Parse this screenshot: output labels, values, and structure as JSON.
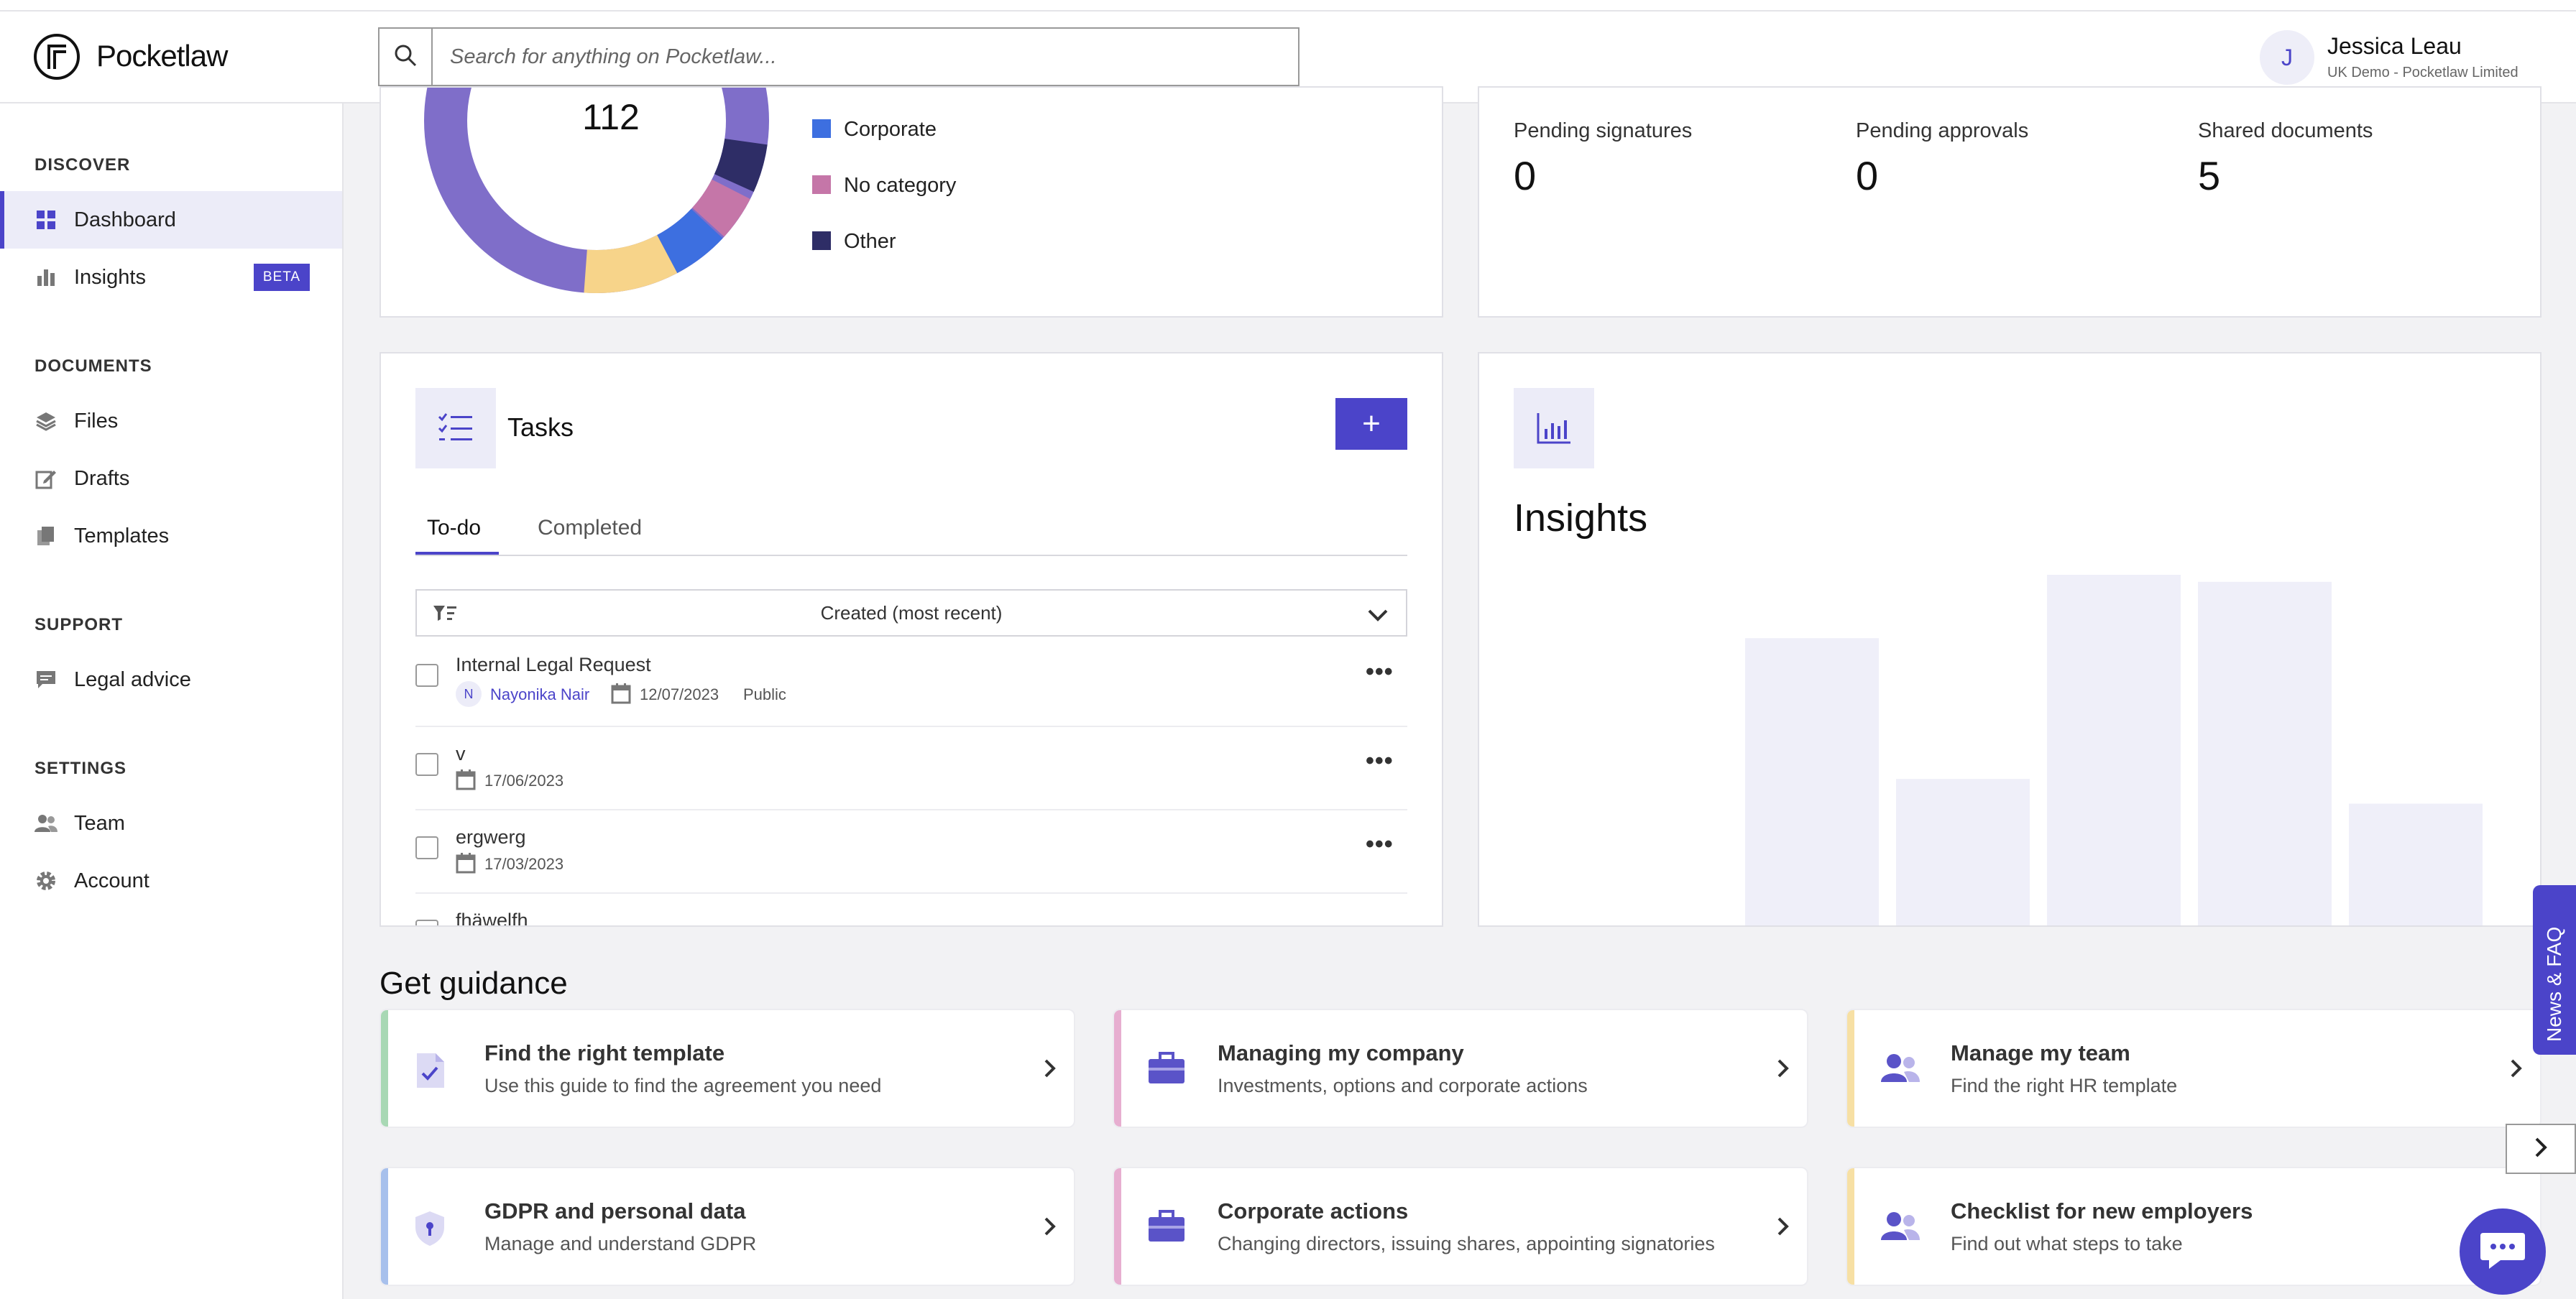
{
  "app": {
    "name": "Pocketlaw"
  },
  "search": {
    "placeholder": "Search for anything on Pocketlaw..."
  },
  "user": {
    "initial": "J",
    "name": "Jessica Leau",
    "org": "UK Demo - Pocketlaw Limited"
  },
  "sidebar": {
    "sections": [
      {
        "heading": "DISCOVER",
        "items": [
          {
            "label": "Dashboard",
            "icon": "grid-icon",
            "active": true
          },
          {
            "label": "Insights",
            "icon": "bar-chart-icon",
            "badge": "BETA"
          }
        ]
      },
      {
        "heading": "DOCUMENTS",
        "items": [
          {
            "label": "Files",
            "icon": "layers-icon"
          },
          {
            "label": "Drafts",
            "icon": "edit-icon"
          },
          {
            "label": "Templates",
            "icon": "copy-icon"
          }
        ]
      },
      {
        "heading": "SUPPORT",
        "items": [
          {
            "label": "Legal advice",
            "icon": "chat-icon"
          }
        ]
      },
      {
        "heading": "SETTINGS",
        "items": [
          {
            "label": "Team",
            "icon": "people-icon"
          },
          {
            "label": "Account",
            "icon": "gear-icon"
          }
        ]
      }
    ]
  },
  "category_chart": {
    "total": "112",
    "legend": [
      {
        "label": "Corporate",
        "color": "#3d6fe0"
      },
      {
        "label": "No category",
        "color": "#c576a8"
      },
      {
        "label": "Other",
        "color": "#2e2d66"
      }
    ],
    "colors": {
      "main": "#7f6ec9",
      "yellow": "#f7d48a"
    }
  },
  "stats": [
    {
      "label": "Pending signatures",
      "value": "0"
    },
    {
      "label": "Pending approvals",
      "value": "0"
    },
    {
      "label": "Shared documents",
      "value": "5"
    }
  ],
  "tasks": {
    "title": "Tasks",
    "add_label": "+",
    "tabs": [
      "To-do",
      "Completed"
    ],
    "sort_label": "Created (most recent)",
    "items": [
      {
        "name": "Internal Legal Request",
        "assignee_initial": "N",
        "assignee": "Nayonika Nair",
        "date": "12/07/2023",
        "visibility": "Public"
      },
      {
        "name": "v",
        "date": "17/06/2023"
      },
      {
        "name": "ergwerg",
        "date": "17/03/2023"
      },
      {
        "name": "fhäwelfh"
      }
    ]
  },
  "insights": {
    "title": "Insights",
    "bar_levels": [
      0.82,
      0.42,
      1.0,
      0.98,
      0.35
    ]
  },
  "guidance": {
    "title": "Get guidance",
    "cards": [
      {
        "title": "Find the right template",
        "desc": "Use this guide to find the agreement you need",
        "accent": "#a8d8b4",
        "icon": "document-check-icon"
      },
      {
        "title": "Managing my company",
        "desc": "Investments, options and corporate actions",
        "accent": "#e7aed0",
        "icon": "briefcase-icon"
      },
      {
        "title": "Manage my team",
        "desc": "Find the right HR template",
        "accent": "#f7e0a4",
        "icon": "people-icon"
      },
      {
        "title": "GDPR and personal data",
        "desc": "Manage and understand GDPR",
        "accent": "#a7c0ec",
        "icon": "shield-icon"
      },
      {
        "title": "Corporate actions",
        "desc": "Changing directors, issuing shares, appointing signatories",
        "accent": "#e7aed0",
        "icon": "briefcase-icon"
      },
      {
        "title": "Checklist for new employers",
        "desc": "Find out what steps to take",
        "accent": "#f7e0a4",
        "icon": "people-icon"
      }
    ]
  },
  "news_tab": {
    "label": "News & FAQ"
  },
  "brand": {
    "accent": "#4b44c9"
  }
}
